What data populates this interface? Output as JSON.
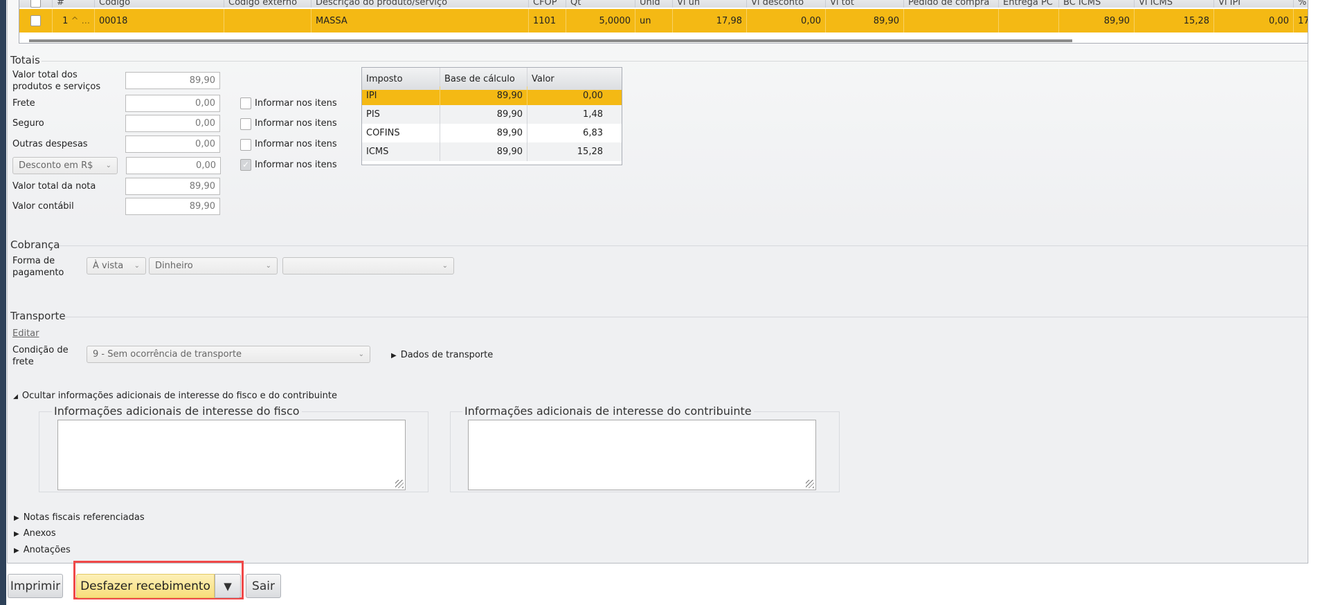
{
  "grid": {
    "columns": [
      "",
      "#",
      "Código",
      "Código externo",
      "Descrição do produto/serviço",
      "CFOP",
      "Qt",
      "Unid",
      "Vl un",
      "Vl desconto",
      "Vl tot",
      "Pedido de compra",
      "Entrega PC",
      "BC ICMS",
      "Vl ICMS",
      "Vl IPI",
      "%"
    ],
    "rows": [
      {
        "num": "1",
        "expand": "^ ...",
        "codigo": "00018",
        "codigo_externo": "",
        "descricao": "MASSA",
        "cfop": "1101",
        "qt": "5,0000",
        "unid": "un",
        "vl_un": "17,98",
        "vl_desconto": "0,00",
        "vl_tot": "89,90",
        "pedido": "",
        "entrega": "",
        "bc_icms": "89,90",
        "vl_icms": "15,28",
        "vl_ipi": "0,00",
        "pct": "17"
      }
    ],
    "selected_color": "#f4b914"
  },
  "totais": {
    "title": "Totais",
    "valor_produtos_label": "Valor total dos produtos e serviços",
    "valor_produtos": "89,90",
    "frete_label": "Frete",
    "frete": "0,00",
    "seguro_label": "Seguro",
    "seguro": "0,00",
    "outras_label": "Outras despesas",
    "outras": "0,00",
    "desconto_select": "Desconto em R$",
    "desconto": "0,00",
    "valor_nota_label": "Valor total da nota",
    "valor_nota": "89,90",
    "valor_contabil_label": "Valor contábil",
    "valor_contabil": "89,90",
    "informar_label": "Informar nos itens",
    "informar_checked": [
      false,
      false,
      false,
      true
    ]
  },
  "impostos": {
    "headers": [
      "Imposto",
      "Base de cálculo",
      "Valor"
    ],
    "rows": [
      [
        "IPI",
        "89,90",
        "0,00"
      ],
      [
        "PIS",
        "89,90",
        "1,48"
      ],
      [
        "COFINS",
        "89,90",
        "6,83"
      ],
      [
        "ICMS",
        "89,90",
        "15,28"
      ]
    ]
  },
  "cobranca": {
    "title": "Cobrança",
    "forma_label": "Forma de pagamento",
    "prazo": "À vista",
    "meio": "Dinheiro",
    "extra": ""
  },
  "transporte": {
    "title": "Transporte",
    "editar": "Editar",
    "condicao_label": "Condição de frete",
    "condicao": "9 - Sem ocorrência de transporte",
    "dados": "Dados de transporte"
  },
  "adicionais": {
    "toggle": "Ocultar informações adicionais de interesse do fisco e do contribuinte",
    "fisco": "Informações adicionais de interesse do fisco",
    "contribuinte": "Informações adicionais de interesse do contribuinte",
    "fisco_value": "",
    "contribuinte_value": ""
  },
  "sections": {
    "notas": "Notas fiscais referenciadas",
    "anexos": "Anexos",
    "anotacoes": "Anotações"
  },
  "buttons": {
    "imprimir": "Imprimir",
    "desfazer": "Desfazer recebimento",
    "dropdown": "▼",
    "sair": "Sair"
  }
}
